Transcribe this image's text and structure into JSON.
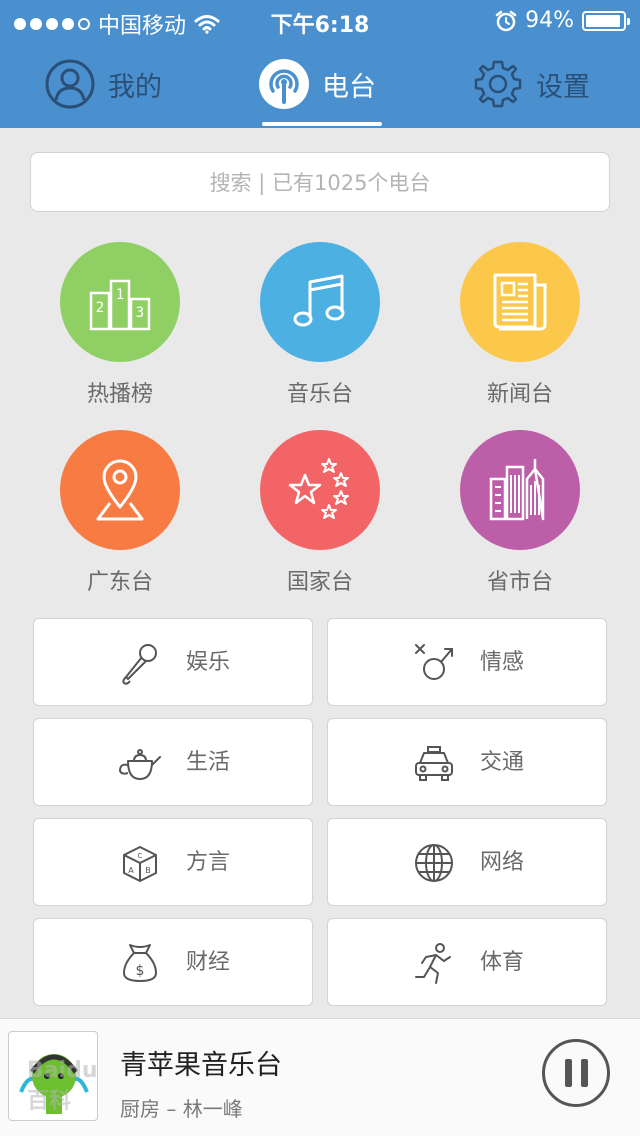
{
  "status": {
    "carrier": "中国移动",
    "time": "下午6:18",
    "battery": "94%",
    "battery_level": 0.94
  },
  "nav": {
    "mine": "我的",
    "radio": "电台",
    "settings": "设置",
    "active": "radio"
  },
  "search": {
    "placeholder": "搜索 | 已有1025个电台"
  },
  "circles": [
    {
      "label": "热播榜",
      "color": "#8fcf64",
      "icon": "ranking-podium-icon"
    },
    {
      "label": "音乐台",
      "color": "#4db0e2",
      "icon": "music-note-icon"
    },
    {
      "label": "新闻台",
      "color": "#fbc84c",
      "icon": "newspaper-icon"
    },
    {
      "label": "广东台",
      "color": "#f77b43",
      "icon": "map-pin-icon"
    },
    {
      "label": "国家台",
      "color": "#f26466",
      "icon": "stars-icon"
    },
    {
      "label": "省市台",
      "color": "#bd5ea8",
      "icon": "buildings-icon"
    }
  ],
  "tiles": [
    {
      "label": "娱乐",
      "icon": "microphone-icon"
    },
    {
      "label": "情感",
      "icon": "gender-symbol-icon"
    },
    {
      "label": "生活",
      "icon": "teapot-icon"
    },
    {
      "label": "交通",
      "icon": "taxi-icon"
    },
    {
      "label": "方言",
      "icon": "letter-blocks-icon"
    },
    {
      "label": "网络",
      "icon": "globe-icon"
    },
    {
      "label": "财经",
      "icon": "money-bag-icon"
    },
    {
      "label": "体育",
      "icon": "runner-icon"
    }
  ],
  "player": {
    "station": "青苹果音乐台",
    "track": "厨房 – 林一峰",
    "cover_watermark": "Baidu 百科",
    "state": "playing"
  }
}
